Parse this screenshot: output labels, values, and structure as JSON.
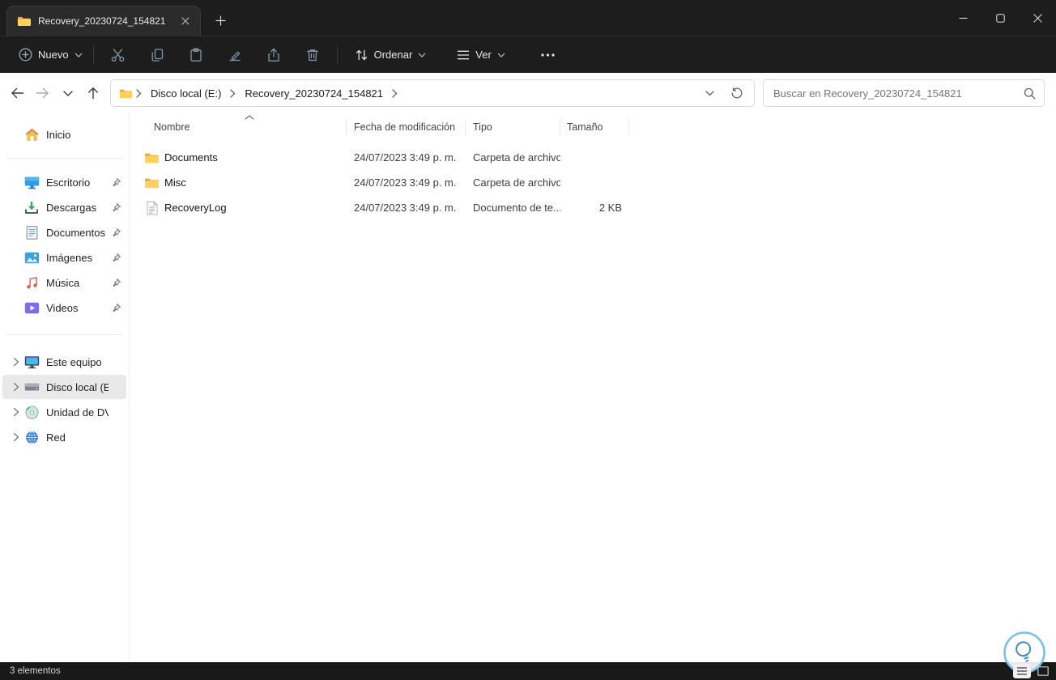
{
  "window": {
    "tab_title": "Recovery_20230724_154821",
    "status_text": "3 elementos"
  },
  "toolbar": {
    "new_label": "Nuevo",
    "sort_label": "Ordenar",
    "view_label": "Ver"
  },
  "navbar": {
    "breadcrumb": [
      "Disco local (E:)",
      "Recovery_20230724_154821"
    ],
    "search_placeholder": "Buscar en Recovery_20230724_154821"
  },
  "sidebar": {
    "items": [
      {
        "label": "Inicio",
        "icon": "home-icon",
        "pinned": false,
        "selected": false
      },
      {
        "label": "Escritorio",
        "icon": "desktop-icon",
        "pinned": true,
        "selected": false
      },
      {
        "label": "Descargas",
        "icon": "downloads-icon",
        "pinned": true,
        "selected": false
      },
      {
        "label": "Documentos",
        "icon": "documents-icon",
        "pinned": true,
        "selected": false
      },
      {
        "label": "Imágenes",
        "icon": "pictures-icon",
        "pinned": true,
        "selected": false
      },
      {
        "label": "Música",
        "icon": "music-icon",
        "pinned": true,
        "selected": false
      },
      {
        "label": "Videos",
        "icon": "videos-icon",
        "pinned": true,
        "selected": false
      },
      {
        "label": "Este equipo",
        "icon": "computer-icon",
        "pinned": false,
        "selected": false
      },
      {
        "label": "Disco local (E:)",
        "icon": "drive-icon",
        "pinned": false,
        "selected": true
      },
      {
        "label": "Unidad de DVD (D:)",
        "icon": "dvd-icon",
        "pinned": false,
        "selected": false
      },
      {
        "label": "Red",
        "icon": "network-icon",
        "pinned": false,
        "selected": false
      }
    ]
  },
  "files": {
    "columns": [
      "Nombre",
      "Fecha de modificación",
      "Tipo",
      "Tamaño"
    ],
    "rows": [
      {
        "name": "Documents",
        "modified": "24/07/2023 3:49 p. m.",
        "type": "Carpeta de archivos",
        "size": "",
        "icon": "folder-icon"
      },
      {
        "name": "Misc",
        "modified": "24/07/2023 3:49 p. m.",
        "type": "Carpeta de archivos",
        "size": "",
        "icon": "folder-icon"
      },
      {
        "name": "RecoveryLog",
        "modified": "24/07/2023 3:49 p. m.",
        "type": "Documento de te...",
        "size": "2 KB",
        "icon": "text-document-icon"
      }
    ]
  }
}
